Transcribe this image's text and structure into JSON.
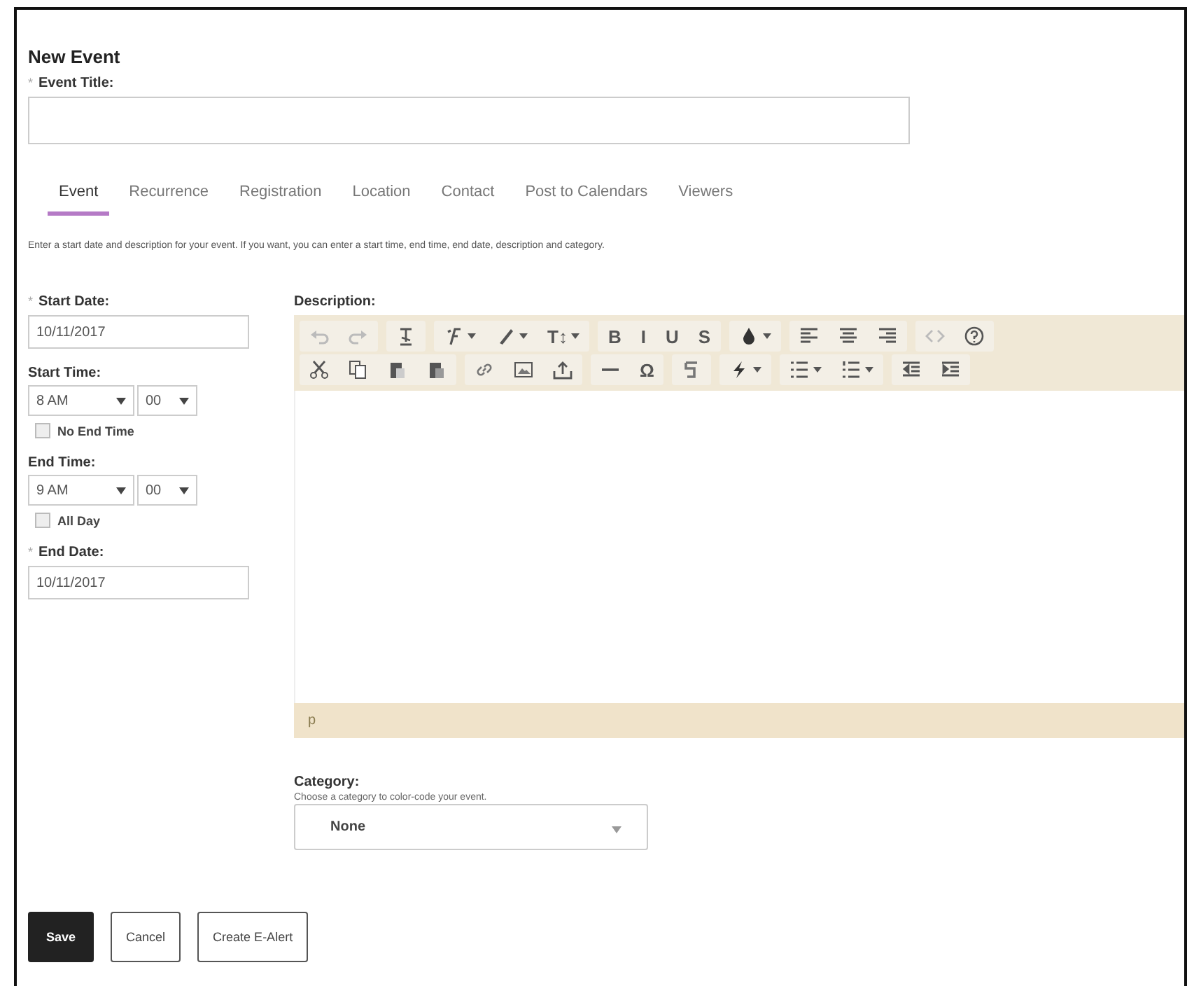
{
  "heading": "New Event",
  "title_field": {
    "label": "Event Title:",
    "marker": "*"
  },
  "tabs": [
    {
      "label": "Event",
      "selected": true
    },
    {
      "label": "Recurrence",
      "selected": false
    },
    {
      "label": "Registration",
      "selected": false
    },
    {
      "label": "Location",
      "selected": false
    },
    {
      "label": "Contact",
      "selected": false
    },
    {
      "label": "Post to Calendars",
      "selected": false
    },
    {
      "label": "Viewers",
      "selected": false
    }
  ],
  "instructions": "Enter a start date and description for your event. If you want, you can enter a start time, end time, end date, description and category.",
  "start_date": {
    "label": "Start Date:",
    "marker": "*",
    "value": "10/11/2017"
  },
  "start_time": {
    "label": "Start Time:",
    "hour": "8 AM",
    "minute": "00",
    "checkbox": {
      "label": "No End Time",
      "checked": false
    }
  },
  "end_time": {
    "label": "End Time:",
    "hour": "9 AM",
    "minute": "00",
    "checkbox": {
      "label": "All Day",
      "checked": false
    }
  },
  "end_date": {
    "label": "End Date:",
    "marker": "*",
    "value": "10/11/2017"
  },
  "description": {
    "label": "Description:",
    "toolbar": [
      [
        [
          {
            "kind": "undo"
          },
          {
            "kind": "redo"
          }
        ],
        [
          {
            "kind": "clearformat"
          }
        ],
        [
          {
            "kind": "font",
            "dropdown": true
          },
          {
            "kind": "pen",
            "dropdown": true
          },
          {
            "kind": "glyph",
            "text": "T↕",
            "dropdown": true
          }
        ],
        [
          {
            "kind": "glyph",
            "text": "B"
          },
          {
            "kind": "glyph",
            "text": "I"
          },
          {
            "kind": "glyph",
            "text": "U"
          },
          {
            "kind": "glyph",
            "text": "S"
          }
        ],
        [
          {
            "kind": "drop",
            "dropdown": true
          }
        ],
        [
          {
            "kind": "alignleft"
          },
          {
            "kind": "aligncenter"
          },
          {
            "kind": "alignright"
          }
        ],
        [
          {
            "kind": "code"
          },
          {
            "kind": "help"
          }
        ]
      ],
      [
        [
          {
            "kind": "cut"
          },
          {
            "kind": "copy"
          },
          {
            "kind": "paste"
          },
          {
            "kind": "pasteword"
          }
        ],
        [
          {
            "kind": "link"
          },
          {
            "kind": "image"
          },
          {
            "kind": "upload"
          }
        ],
        [
          {
            "kind": "rule"
          },
          {
            "kind": "glyph",
            "text": "Ω"
          }
        ],
        [
          {
            "kind": "spell"
          }
        ],
        [
          {
            "kind": "bolt",
            "dropdown": true
          }
        ],
        [
          {
            "kind": "bullets",
            "dropdown": true
          },
          {
            "kind": "numbers",
            "dropdown": true
          }
        ],
        [
          {
            "kind": "outdent"
          },
          {
            "kind": "indent"
          }
        ]
      ]
    ],
    "status": "p"
  },
  "category": {
    "label": "Category:",
    "hint": "Choose a category to color-code your event.",
    "value": "None"
  },
  "buttons": [
    {
      "label": "Save",
      "kind": "primary"
    },
    {
      "label": "Cancel",
      "kind": "plain"
    },
    {
      "label": "Create E-Alert",
      "kind": "plain"
    }
  ]
}
